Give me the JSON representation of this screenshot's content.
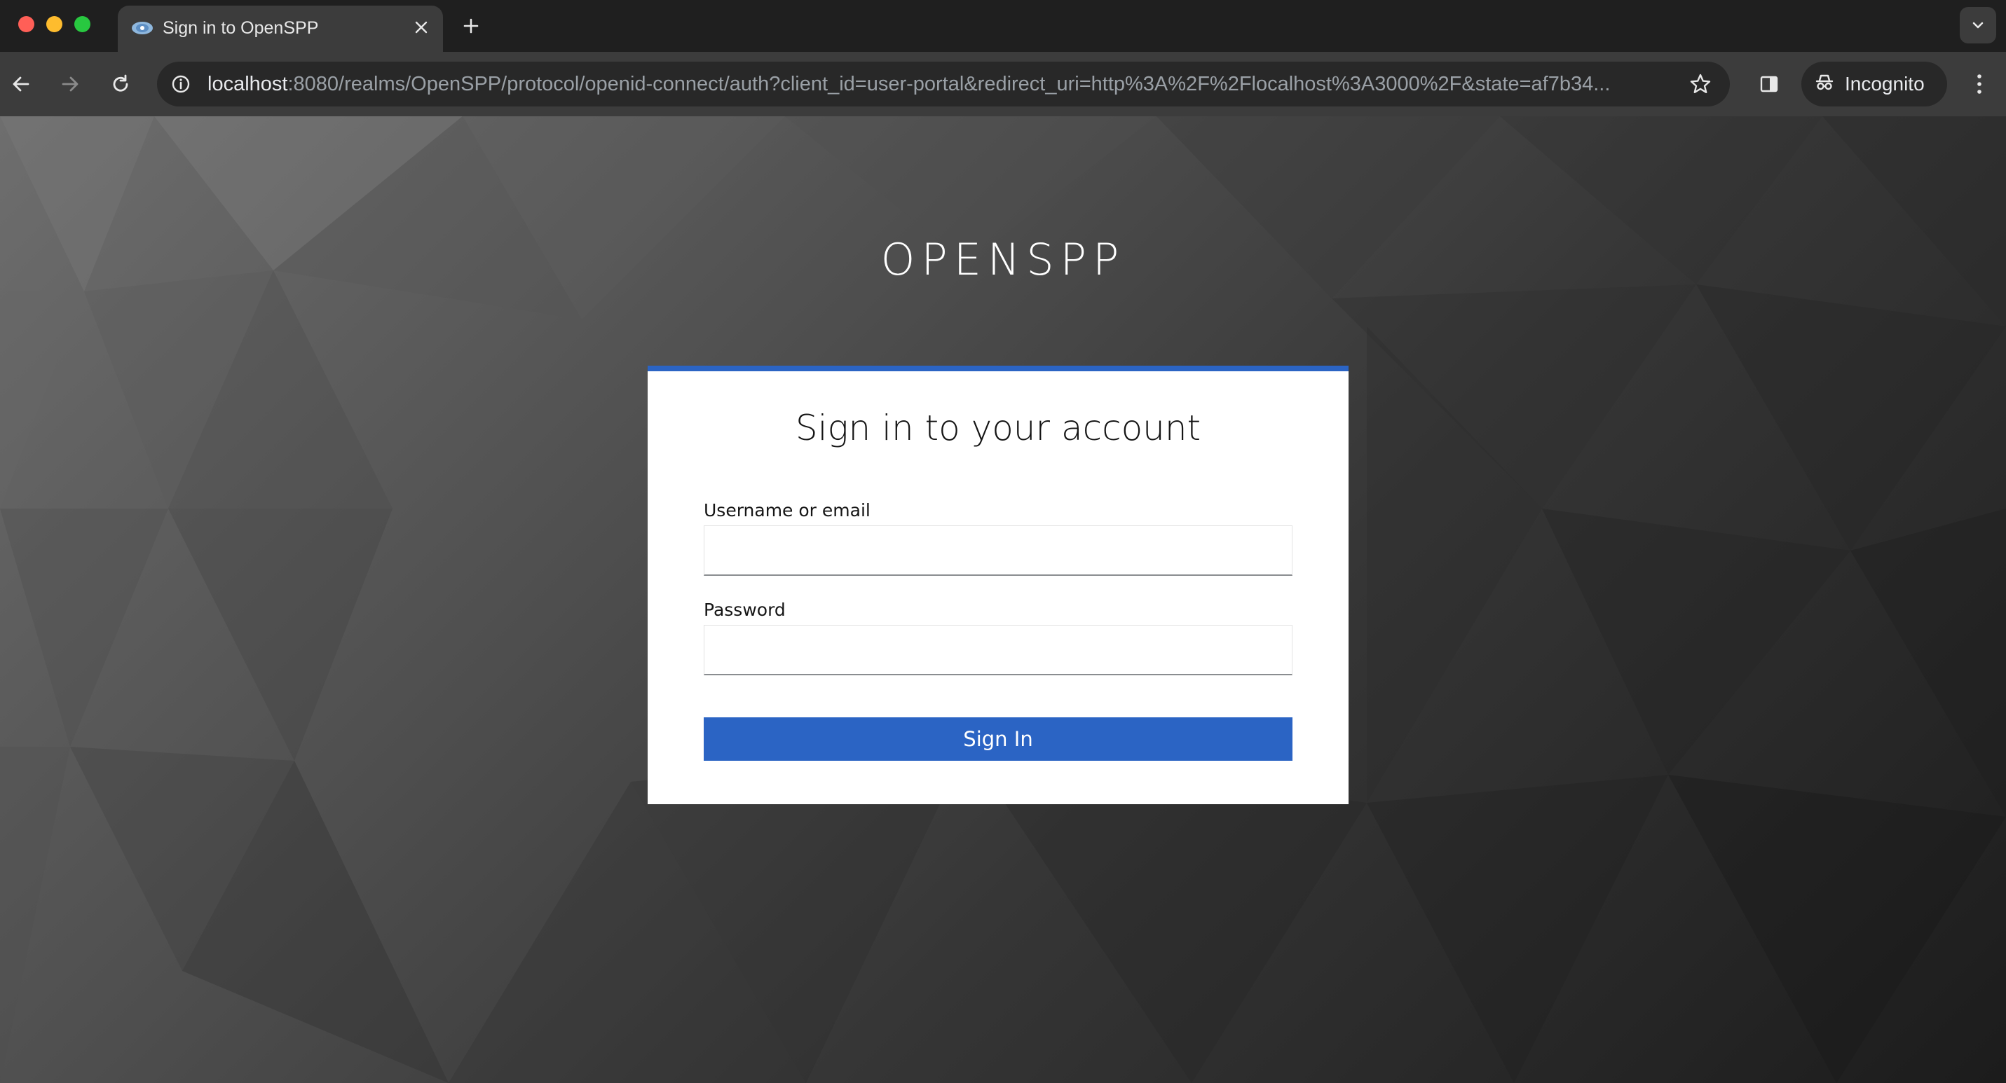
{
  "browser": {
    "tab": {
      "title": "Sign in to OpenSPP",
      "favicon": "openspp-favicon"
    },
    "address_bar": {
      "host": "localhost",
      "rest": ":8080/realms/OpenSPP/protocol/openid-connect/auth?client_id=user-portal&redirect_uri=http%3A%2F%2Flocalhost%3A3000%2F&state=af7b34..."
    },
    "incognito_label": "Incognito",
    "colors": {
      "chrome_dark": "#1f1f1f",
      "toolbar": "#3c3c3c",
      "omnibox": "#282828"
    }
  },
  "page": {
    "brand": "OPENSPP",
    "card": {
      "title": "Sign in to your account",
      "username_label": "Username or email",
      "username_value": "",
      "password_label": "Password",
      "password_value": "",
      "submit_label": "Sign In"
    },
    "colors": {
      "accent": "#2b64c4",
      "card_bg": "#ffffff",
      "text": "#151515"
    }
  }
}
